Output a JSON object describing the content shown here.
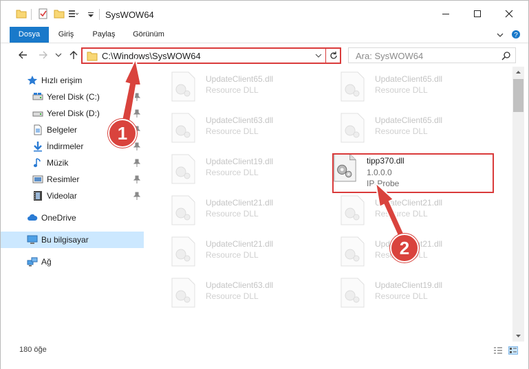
{
  "window": {
    "title": "SysWOW64"
  },
  "ribbon": {
    "tabs": [
      "Dosya",
      "Giriş",
      "Paylaş",
      "Görünüm"
    ]
  },
  "address": {
    "path": "C:\\Windows\\SysWOW64",
    "search_placeholder": "Ara: SysWOW64"
  },
  "sidebar": {
    "quick_access": "Hızlı erişim",
    "items": [
      {
        "label": "Yerel Disk (C:)",
        "icon": "drive-icon"
      },
      {
        "label": "Yerel Disk (D:)",
        "icon": "drive-icon"
      },
      {
        "label": "Belgeler",
        "icon": "documents-icon"
      },
      {
        "label": "İndirmeler",
        "icon": "downloads-icon"
      },
      {
        "label": "Müzik",
        "icon": "music-icon"
      },
      {
        "label": "Resimler",
        "icon": "pictures-icon"
      },
      {
        "label": "Videolar",
        "icon": "videos-icon"
      }
    ],
    "onedrive": "OneDrive",
    "this_pc": "Bu bilgisayar",
    "network": "Ağ"
  },
  "files": {
    "left": [
      {
        "name": "UpdateClient65.dll",
        "desc": "Resource DLL"
      },
      {
        "name": "UpdateClient63.dll",
        "desc": "Resource DLL"
      },
      {
        "name": "UpdateClient19.dll",
        "desc": "Resource DLL"
      },
      {
        "name": "UpdateClient21.dll",
        "desc": "Resource DLL"
      },
      {
        "name": "UpdateClient21.dll",
        "desc": "Resource DLL"
      },
      {
        "name": "UpdateClient63.dll",
        "desc": "Resource DLL"
      }
    ],
    "right": [
      {
        "name": "UpdateClient65.dll",
        "desc": "Resource DLL"
      },
      {
        "name": "UpdateClient65.dll",
        "desc": "Resource DLL"
      },
      {
        "name": "tipp370.dll",
        "version": "1.0.0.0",
        "desc": "IP-Probe"
      },
      {
        "name": "UpdateClient21.dll",
        "desc": "Resource DLL"
      },
      {
        "name": "UpdateClient21.dll",
        "desc": "Resource DLL"
      },
      {
        "name": "UpdateClient19.dll",
        "desc": "Resource DLL"
      }
    ]
  },
  "status": {
    "item_count": "180 öğe"
  },
  "annotations": {
    "step1": "1",
    "step2": "2",
    "color": "#d9433d"
  }
}
